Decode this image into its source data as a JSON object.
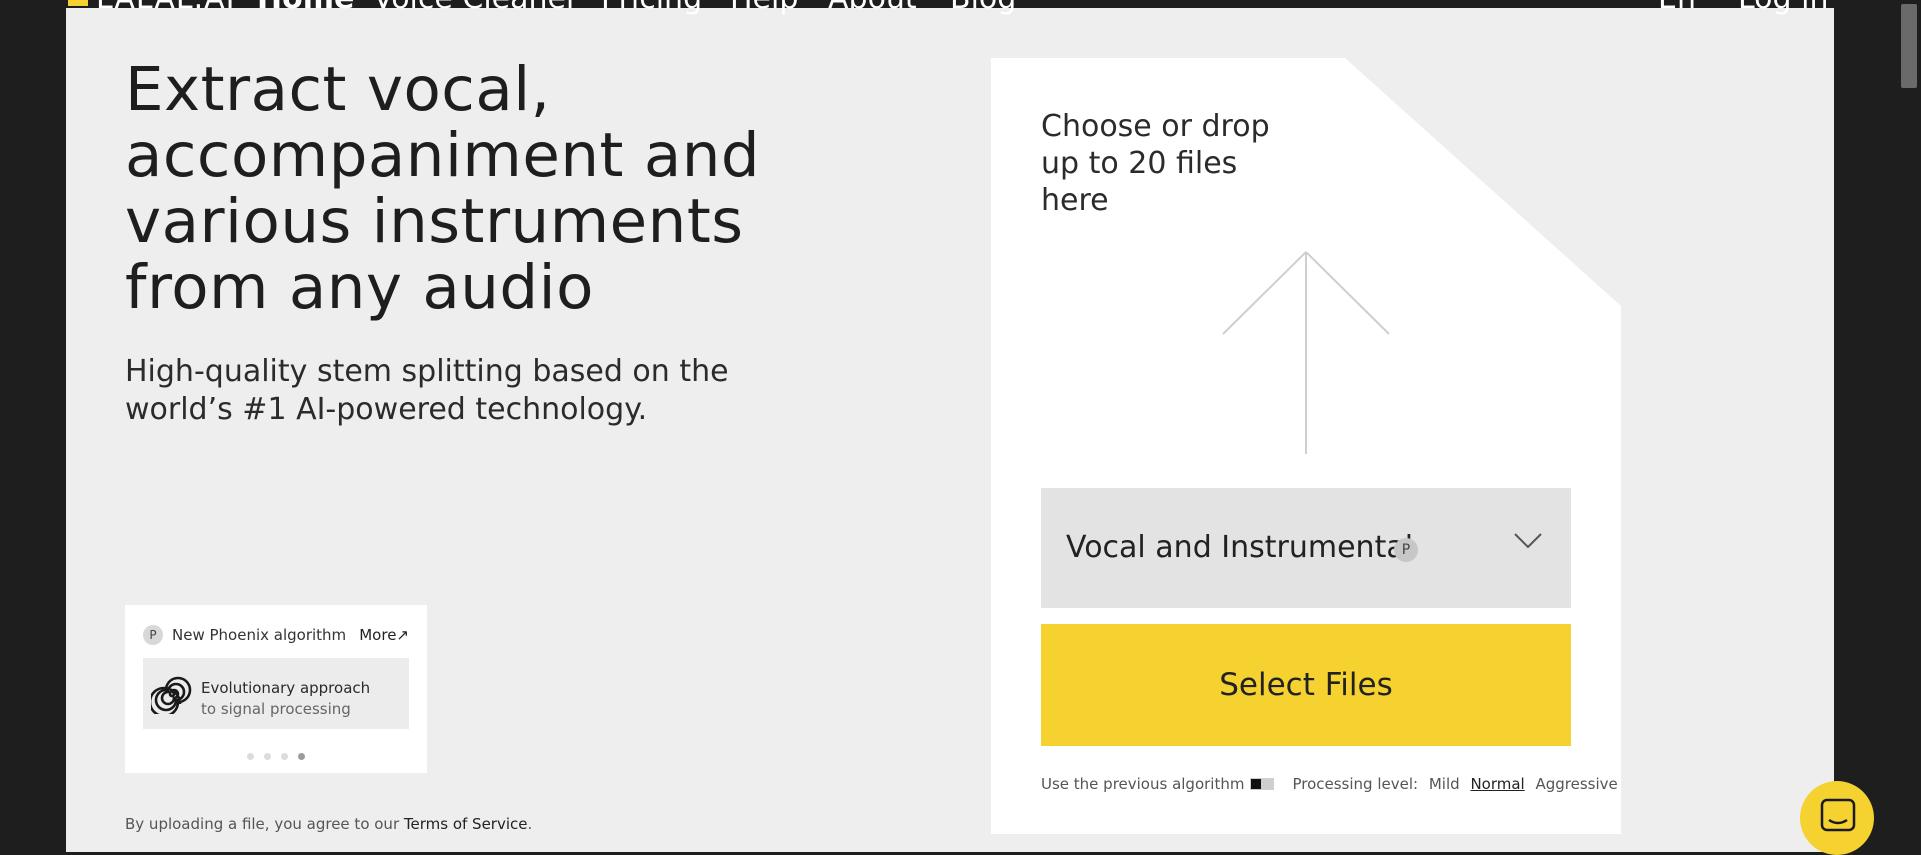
{
  "nav": {
    "logo": "LALAL.AI",
    "items": [
      {
        "label": "Home",
        "active": true
      },
      {
        "label": "Voice Cleaner"
      },
      {
        "label": "Pricing"
      },
      {
        "label": "Help"
      },
      {
        "label": "About"
      },
      {
        "label": "Blog"
      }
    ],
    "lang": "En",
    "login": "Log in"
  },
  "hero": {
    "title_lines": [
      "Extract vocal,",
      "accompaniment and",
      "various instruments",
      "from any audio"
    ],
    "subtitle_lines": [
      "High-quality stem splitting based on the",
      "world’s #1 AI-powered technology."
    ]
  },
  "promo": {
    "badge": "P",
    "title": "New Phoenix algorithm",
    "more": "More",
    "card_line1": "Evolutionary approach",
    "card_line2": "to signal processing",
    "slides_total": 4,
    "slide_active": 4
  },
  "tos": {
    "prefix": "By uploading a file, you agree to our",
    "link": "Terms of Service",
    "suffix": "."
  },
  "upload": {
    "drop_lines": [
      "Choose or drop",
      "up to 20 files",
      "here"
    ],
    "stem_select": "Vocal and Instrumental",
    "stem_badge": "P",
    "select_button": "Select Files",
    "prev_algo_label": "Use the previous algorithm",
    "processing_label": "Processing level:",
    "levels": [
      "Mild",
      "Normal",
      "Aggressive"
    ],
    "level_selected": "Normal"
  },
  "colors": {
    "accent": "#f5d230",
    "page_bg": "#eeeeee",
    "dark": "#1f1e1e"
  },
  "icons": {
    "upload": "arrow-up-icon",
    "dropdown": "chevron-down-icon",
    "algorithm": "spiral-icon",
    "chat": "chat-icon"
  }
}
